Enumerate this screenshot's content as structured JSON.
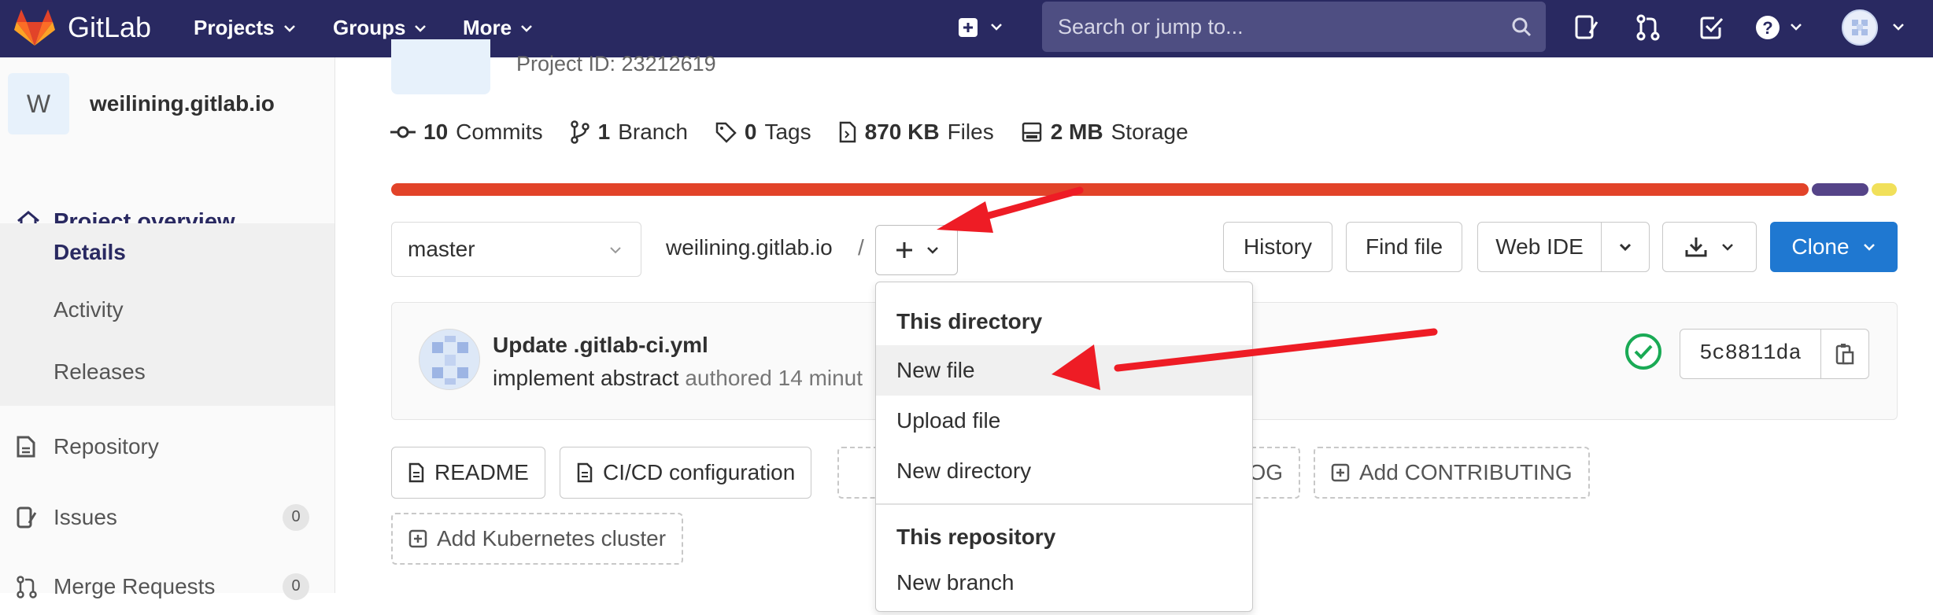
{
  "colors": {
    "navbar": "#292961",
    "accent": "#1f78d1",
    "arrow": "#ee1c25",
    "success": "#1aaa55",
    "lang_segments": [
      "#e24329",
      "#554488",
      "#f1e05a"
    ]
  },
  "navbar": {
    "brand": "GitLab",
    "menus": [
      {
        "label": "Projects"
      },
      {
        "label": "Groups"
      },
      {
        "label": "More"
      }
    ],
    "search_placeholder": "Search or jump to...",
    "icons": [
      "plus-square-icon",
      "search-icon",
      "issues-icon",
      "merge-request-icon",
      "todo-icon",
      "help-icon",
      "user-avatar"
    ]
  },
  "sidebar": {
    "project_initial": "W",
    "project_name": "weilining.gitlab.io",
    "items": [
      {
        "label": "Project overview"
      },
      {
        "label": "Details"
      },
      {
        "label": "Activity"
      },
      {
        "label": "Releases"
      },
      {
        "label": "Repository"
      },
      {
        "label": "Issues",
        "count": "0"
      },
      {
        "label": "Merge Requests",
        "count": "0"
      }
    ]
  },
  "project": {
    "id_text": "Project ID: 23212619",
    "stats": [
      {
        "value": "10",
        "label": "Commits"
      },
      {
        "value": "1",
        "label": "Branch"
      },
      {
        "value": "0",
        "label": "Tags"
      },
      {
        "value": "870 KB",
        "label": "Files"
      },
      {
        "value": "2 MB",
        "label": "Storage"
      }
    ],
    "language_fractions": [
      0.945,
      0.038,
      0.017
    ]
  },
  "toolbar": {
    "branch": "master",
    "path": "weilining.gitlab.io",
    "separator": "/",
    "history": "History",
    "find_file": "Find file",
    "web_ide": "Web IDE",
    "clone": "Clone"
  },
  "commit": {
    "title": "Update .gitlab-ci.yml",
    "author": "implement abstract",
    "meta": "authored 14 minut",
    "sha": "5c8811da"
  },
  "quick_actions": [
    {
      "label": "README"
    },
    {
      "label": "CI/CD configuration"
    },
    {
      "label": "OG"
    },
    {
      "label": "Add CONTRIBUTING"
    },
    {
      "label": "Add Kubernetes cluster"
    }
  ],
  "dropdown": {
    "header_directory": "This directory",
    "items_directory": [
      "New file",
      "Upload file",
      "New directory"
    ],
    "header_repository": "This repository",
    "items_repository": [
      "New branch"
    ]
  }
}
